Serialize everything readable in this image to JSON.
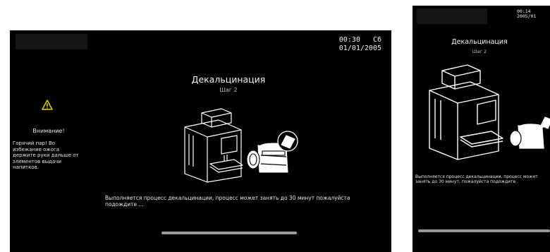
{
  "main": {
    "time": "00:30",
    "code": "C6",
    "date": "01/01/2005",
    "title": "Декальцинация",
    "step": "Шаг 2",
    "warning": {
      "title": "Внимание!",
      "text": "Горячий пар! Во избежание ожога держите руки дальше от элементов выдачи напитков."
    },
    "message": "Выполняется процесс декальцинации, процесс может занять до 30 минут пожалуйста подождите ..."
  },
  "side": {
    "time": "00:14",
    "date": "2005/01",
    "title": "Декальцинация",
    "step": "Шаг 2",
    "message": "Выполняется процесс декальцинации, процесс может занять до 30 минут, пожалуйста подождите ."
  },
  "colors": {
    "background": "#000000",
    "text": "#ffffff",
    "progress_track": "#4a4a4a",
    "progress_fill": "#9a9a9a"
  },
  "icons": {
    "warning": "warning-triangle-icon",
    "machine": "coffee-machine-illustration",
    "bottle": "descaling-bottle-illustration"
  }
}
